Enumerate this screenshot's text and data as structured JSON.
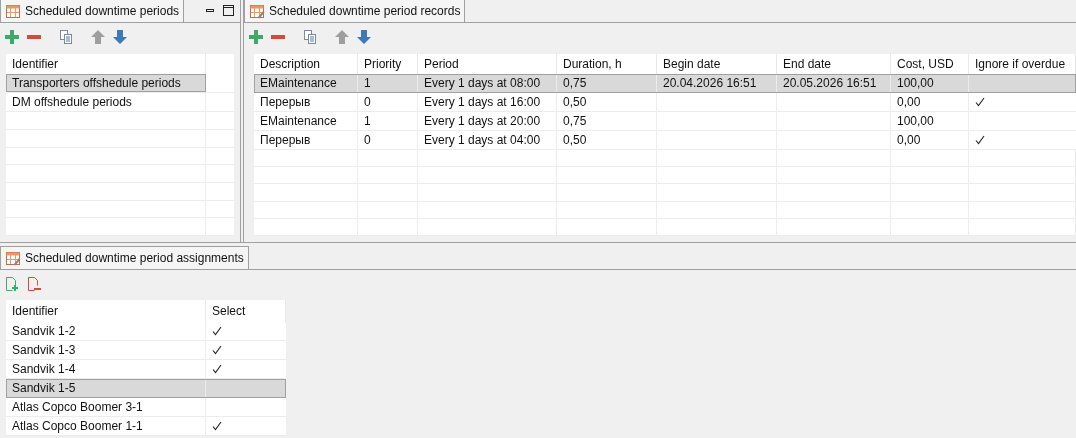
{
  "periods_panel": {
    "title": "Scheduled downtime periods",
    "toolbar": [
      {
        "kind": "add",
        "disabled": false
      },
      {
        "kind": "remove",
        "disabled": false
      },
      {
        "kind": "copy",
        "disabled": false
      },
      {
        "kind": "up",
        "disabled": true
      },
      {
        "kind": "down",
        "disabled": false
      }
    ],
    "columns": [
      "Identifier"
    ],
    "rows": [
      {
        "identifier": "Transporters offshedule periods",
        "selected": true
      },
      {
        "identifier": "DM offshedule periods",
        "selected": false
      }
    ]
  },
  "records_panel": {
    "title": "Scheduled downtime period records",
    "toolbar": [
      {
        "kind": "add",
        "disabled": false
      },
      {
        "kind": "remove",
        "disabled": false
      },
      {
        "kind": "copy",
        "disabled": false
      },
      {
        "kind": "up",
        "disabled": true
      },
      {
        "kind": "down",
        "disabled": false
      }
    ],
    "columns": [
      "Description",
      "Priority",
      "Period",
      "Duration, h",
      "Begin date",
      "End date",
      "Cost, USD",
      "Ignore if overdue"
    ],
    "rows": [
      {
        "description": "EMaintenance",
        "priority": "1",
        "period": "Every 1 days at 08:00",
        "duration": "0,75",
        "begin_date": "20.04.2026 16:51",
        "end_date": "20.05.2026 16:51",
        "cost": "100,00",
        "ignore_if_overdue": false,
        "selected": true
      },
      {
        "description": "Перерыв",
        "priority": "0",
        "period": "Every 1 days at 16:00",
        "duration": "0,50",
        "cost": "0,00",
        "ignore_if_overdue": true,
        "selected": false
      },
      {
        "description": "EMaintenance",
        "priority": "1",
        "period": "Every 1 days at 20:00",
        "duration": "0,75",
        "cost": "100,00",
        "ignore_if_overdue": false,
        "selected": false
      },
      {
        "description": "Перерыв",
        "priority": "0",
        "period": "Every 1 days at 04:00",
        "duration": "0,50",
        "cost": "0,00",
        "ignore_if_overdue": true,
        "selected": false
      }
    ]
  },
  "assignments_panel": {
    "title": "Scheduled downtime period assignments",
    "toolbar": [
      {
        "kind": "add_document",
        "disabled": false
      },
      {
        "kind": "remove_document",
        "disabled": false
      }
    ],
    "columns": [
      "Identifier",
      "Select"
    ],
    "rows": [
      {
        "identifier": "Sandvik 1-2",
        "select": true,
        "selected": false
      },
      {
        "identifier": "Sandvik 1-3",
        "select": true,
        "selected": false
      },
      {
        "identifier": "Sandvik 1-4",
        "select": true,
        "selected": false
      },
      {
        "identifier": "Sandvik 1-5",
        "select": false,
        "selected": true
      },
      {
        "identifier": "Atlas Copco Boomer 3-1",
        "select": false,
        "selected": false
      },
      {
        "identifier": "Atlas Copco Boomer 1-1",
        "select": true,
        "selected": false
      }
    ]
  }
}
